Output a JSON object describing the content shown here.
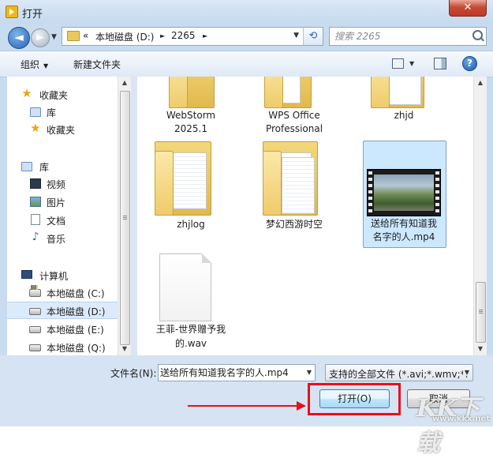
{
  "window": {
    "title": "打开",
    "close_glyph": "✕"
  },
  "nav": {
    "back_glyph": "◄",
    "forward_glyph": "►",
    "breadcrumb": [
      "«",
      "本地磁盘 (D:)",
      "►",
      "2265",
      "►"
    ],
    "refresh_glyph": "⟲",
    "search_placeholder": "搜索 2265"
  },
  "toolbar": {
    "organize": "组织",
    "new_folder": "新建文件夹",
    "help_glyph": "?"
  },
  "sidebar": {
    "groups": [
      {
        "label": "收藏夹",
        "icon": "star-icon",
        "children": [
          {
            "label": "库",
            "icon": "library-icon"
          },
          {
            "label": "收藏夹",
            "icon": "star-icon"
          }
        ]
      },
      {
        "label": "库",
        "icon": "library-icon",
        "children": [
          {
            "label": "视频",
            "icon": "video-icon"
          },
          {
            "label": "图片",
            "icon": "image-icon"
          },
          {
            "label": "文档",
            "icon": "document-icon"
          },
          {
            "label": "音乐",
            "icon": "music-icon"
          }
        ]
      },
      {
        "label": "计算机",
        "icon": "computer-icon",
        "children": [
          {
            "label": "本地磁盘 (C:)",
            "icon": "drive-icon"
          },
          {
            "label": "本地磁盘 (D:)",
            "icon": "drive-icon",
            "selected": true
          },
          {
            "label": "本地磁盘 (E:)",
            "icon": "drive-icon"
          },
          {
            "label": "本地磁盘 (Q:)",
            "icon": "drive-icon"
          }
        ]
      }
    ]
  },
  "files": [
    {
      "name_lines": [
        "WebStorm",
        "2025.1"
      ],
      "type": "folder"
    },
    {
      "name_lines": [
        "WPS Office",
        "Professional"
      ],
      "type": "folder"
    },
    {
      "name_lines": [
        "zhjd"
      ],
      "type": "folder"
    },
    {
      "name_lines": [
        "zhjlog"
      ],
      "type": "folder"
    },
    {
      "name_lines": [
        "梦幻西游时空"
      ],
      "type": "folder"
    },
    {
      "name_lines": [
        "送给所有知道我",
        "名字的人.mp4"
      ],
      "type": "video",
      "selected": true
    },
    {
      "name_lines": [
        "王菲-世界赠予我",
        "的.wav"
      ],
      "type": "audio-file"
    }
  ],
  "footer": {
    "filename_label": "文件名(N):",
    "filename_value": "送给所有知道我名字的人.mp4",
    "filter_value": "支持的全部文件 (*.avi;*.wmv;*.",
    "open_button": "打开(O)",
    "cancel_button": "取消"
  },
  "watermark": {
    "logo": "KK下载",
    "site": "www.kkx.net"
  },
  "colors": {
    "annotation_red": "#e8101a",
    "selection_blue": "#cce8ff",
    "title_bg": "#c5d9ee"
  }
}
